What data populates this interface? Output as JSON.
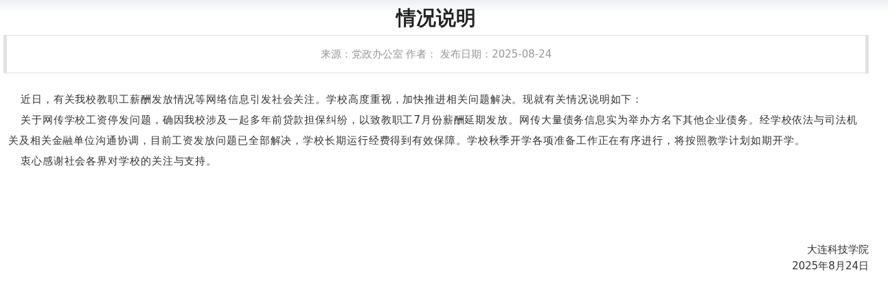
{
  "title": "情况说明",
  "meta": "来源：党政办公室 作者： 发布日期：2025-08-24",
  "paragraphs": [
    "近日，有关我校教职工薪酬发放情况等网络信息引发社会关注。学校高度重视，加快推进相关问题解决。现就有关情况说明如下：",
    "关于网传学校工资停发问题，确因我校涉及一起多年前贷款担保纠纷，以致教职工7月份薪酬延期发放。网传大量债务信息实为举办方名下其他企业债务。经学校依法与司法机关及相关金融单位沟通协调，目前工资发放问题已全部解决，学校长期运行经费得到有效保障。学校秋季开学各项准备工作正在有序进行，将按照教学计划如期开学。",
    "衷心感谢社会各界对学校的关注与支持。"
  ],
  "signature": {
    "organization": "大连科技学院",
    "date": "2025年8月24日"
  }
}
